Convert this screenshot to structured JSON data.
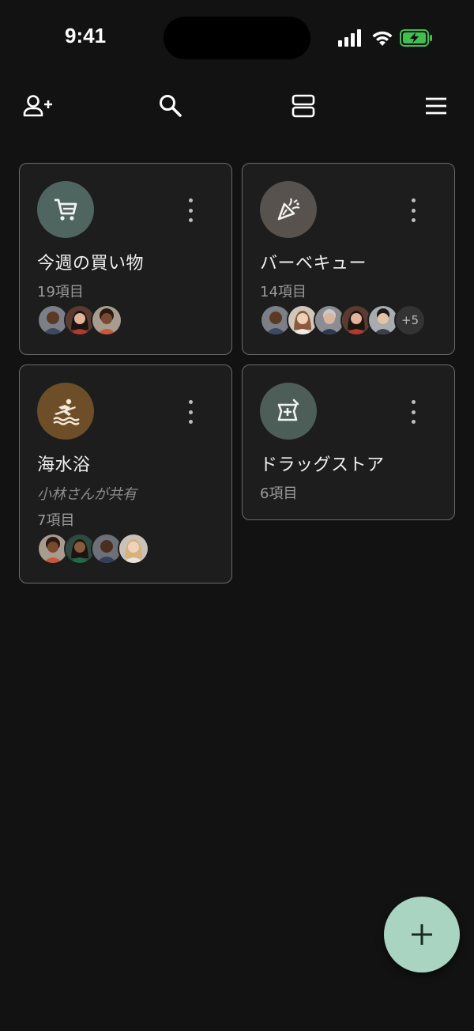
{
  "status_bar": {
    "time": "9:41"
  },
  "toolbar": {
    "icons": [
      "add-person-icon",
      "search-icon",
      "layout-toggle-icon",
      "menu-icon"
    ]
  },
  "lists": [
    {
      "title": "今週の買い物",
      "count": "19項目",
      "icon": "cart-icon",
      "icon_bg": "#4f6560",
      "members": 3,
      "extra_members": ""
    },
    {
      "title": "バーベキュー",
      "count": "14項目",
      "icon": "party-popper-icon",
      "icon_bg": "#57524e",
      "members": 5,
      "extra_members": "+5"
    },
    {
      "title": "海水浴",
      "subtitle": "小林さんが共有",
      "count": "7項目",
      "icon": "surfing-icon",
      "icon_bg": "#6e4e28",
      "members": 4,
      "extra_members": ""
    },
    {
      "title": "ドラッグストア",
      "count": "6項目",
      "icon": "pharmacy-icon",
      "icon_bg": "#4d5e58",
      "members": 0,
      "extra_members": ""
    }
  ],
  "fab": {
    "icon": "plus-icon",
    "color": "#a9d4c1"
  }
}
